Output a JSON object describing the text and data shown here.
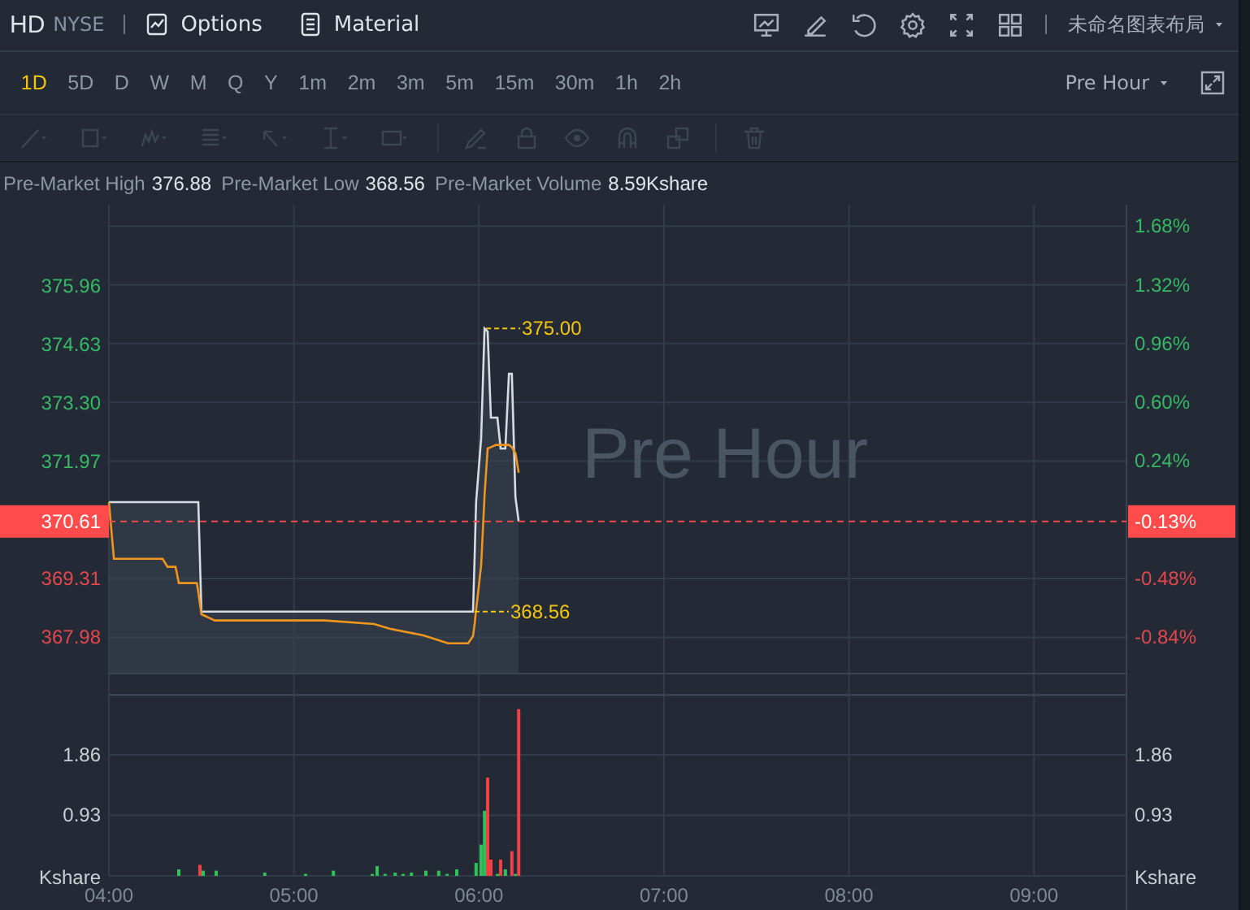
{
  "header": {
    "symbol": "HD",
    "exchange": "NYSE",
    "links": [
      {
        "kind": "options",
        "label": "Options"
      },
      {
        "kind": "material",
        "label": "Material"
      }
    ],
    "layout_menu": "未命名图表布局"
  },
  "timeframes": [
    {
      "label": "1D",
      "selected": true
    },
    {
      "label": "5D",
      "selected": false
    },
    {
      "label": "D",
      "selected": false
    },
    {
      "label": "W",
      "selected": false
    },
    {
      "label": "M",
      "selected": false
    },
    {
      "label": "Q",
      "selected": false
    },
    {
      "label": "Y",
      "selected": false
    },
    {
      "label": "1m",
      "selected": false
    },
    {
      "label": "2m",
      "selected": false
    },
    {
      "label": "3m",
      "selected": false
    },
    {
      "label": "5m",
      "selected": false
    },
    {
      "label": "15m",
      "selected": false
    },
    {
      "label": "30m",
      "selected": false
    },
    {
      "label": "1h",
      "selected": false
    },
    {
      "label": "2h",
      "selected": false
    }
  ],
  "session_menu": "Pre Hour",
  "stats": [
    {
      "label": "Pre-Market High",
      "value": "376.88"
    },
    {
      "label": "Pre-Market Low",
      "value": "368.56"
    },
    {
      "label": "Pre-Market Volume",
      "value": "8.59Kshare"
    }
  ],
  "price_chart": {
    "session_watermark": "Pre Hour",
    "current": {
      "label": "370.61",
      "percent": "-0.13%"
    },
    "high_marker": "375.00",
    "low_marker": "368.56",
    "percent_labels": [
      "1.68%",
      "1.32%",
      "0.96%",
      "0.60%",
      "0.24%",
      "-0.48%",
      "-0.84%"
    ],
    "chart_data": {
      "type": "line",
      "x": [
        4,
        4.027,
        4.29,
        4.317,
        4.36,
        4.378,
        4.475,
        4.483,
        4.5,
        4.572,
        5.167,
        5.433,
        5.517,
        5.7,
        5.833,
        5.942,
        5.968,
        5.977,
        5.985,
        6.012,
        6.03,
        6.047,
        6.065,
        6.092,
        6.1,
        6.117,
        6.143,
        6.162,
        6.178,
        6.197,
        6.215
      ],
      "xlim": [
        4,
        9.5
      ],
      "ylim": [
        367.17,
        377.7
      ],
      "yticks": [
        {
          "value": 375.96,
          "label": "375.96"
        },
        {
          "value": 374.63,
          "label": "374.63"
        },
        {
          "value": 373.3,
          "label": "373.30"
        },
        {
          "value": 371.97,
          "label": "371.97"
        },
        {
          "value": 369.31,
          "label": "369.31"
        },
        {
          "value": 367.98,
          "label": "367.98"
        }
      ],
      "series": [
        {
          "color": "#d8dce2",
          "values": [
            371.05,
            371.05,
            371.05,
            371.05,
            371.05,
            371.05,
            371.05,
            371.05,
            368.56,
            368.56,
            368.56,
            368.56,
            368.56,
            368.56,
            368.56,
            368.56,
            368.56,
            369.8,
            371.05,
            372.5,
            375.0,
            374.93,
            372.97,
            372.97,
            372.97,
            372.27,
            372.27,
            373.97,
            373.97,
            371.16,
            370.61
          ]
        },
        {
          "color": "#f0961e",
          "values": [
            371.05,
            369.76,
            369.76,
            369.58,
            369.58,
            369.21,
            369.21,
            369.0,
            368.5,
            368.36,
            368.36,
            368.28,
            368.17,
            368.02,
            367.84,
            367.84,
            368.0,
            368.28,
            368.6,
            369.61,
            371.2,
            372.27,
            372.3,
            372.35,
            372.35,
            372.35,
            372.35,
            372.35,
            372.3,
            372.16,
            371.72
          ]
        }
      ]
    }
  },
  "volume_chart": {
    "unit_left": "Kshare",
    "unit_right": "Kshare",
    "right_labels": [
      "1.86",
      "0.93"
    ],
    "chart_data": {
      "type": "bar",
      "x": [
        4.378,
        4.492,
        4.51,
        4.58,
        4.843,
        5.063,
        5.213,
        5.423,
        5.45,
        5.493,
        5.547,
        5.59,
        5.635,
        5.713,
        5.783,
        5.828,
        5.88,
        5.985,
        6.012,
        6.03,
        6.047,
        6.065,
        6.1,
        6.117,
        6.143,
        6.178,
        6.197,
        6.215
      ],
      "xlim": [
        4,
        9.5
      ],
      "ylim": [
        0,
        2.77
      ],
      "yticks": [
        {
          "value": 0.93,
          "label": "0.93"
        },
        {
          "value": 1.86,
          "label": "1.86"
        }
      ],
      "xticks": [
        {
          "value": 4,
          "label": "04:00"
        },
        {
          "value": 5,
          "label": "05:00"
        },
        {
          "value": 6,
          "label": "06:00"
        },
        {
          "value": 7,
          "label": "07:00"
        },
        {
          "value": 8,
          "label": "08:00"
        },
        {
          "value": 9,
          "label": "09:00"
        }
      ],
      "series": [
        {
          "color": "#2fc05a",
          "values": [
            0.1,
            null,
            0.08,
            0.08,
            0.05,
            0.03,
            0.08,
            0.03,
            0.15,
            0.03,
            0.05,
            0.03,
            0.05,
            0.08,
            0.08,
            0.03,
            0.1,
            0.2,
            0.48,
            1.0,
            null,
            null,
            0.03,
            null,
            0.1,
            null,
            0.03,
            null
          ]
        },
        {
          "color": "#ef4046",
          "values": [
            null,
            0.17,
            null,
            null,
            null,
            null,
            null,
            null,
            null,
            null,
            null,
            null,
            null,
            null,
            null,
            null,
            null,
            null,
            null,
            null,
            1.51,
            0.25,
            null,
            0.25,
            null,
            0.38,
            null,
            2.56
          ]
        }
      ]
    }
  }
}
